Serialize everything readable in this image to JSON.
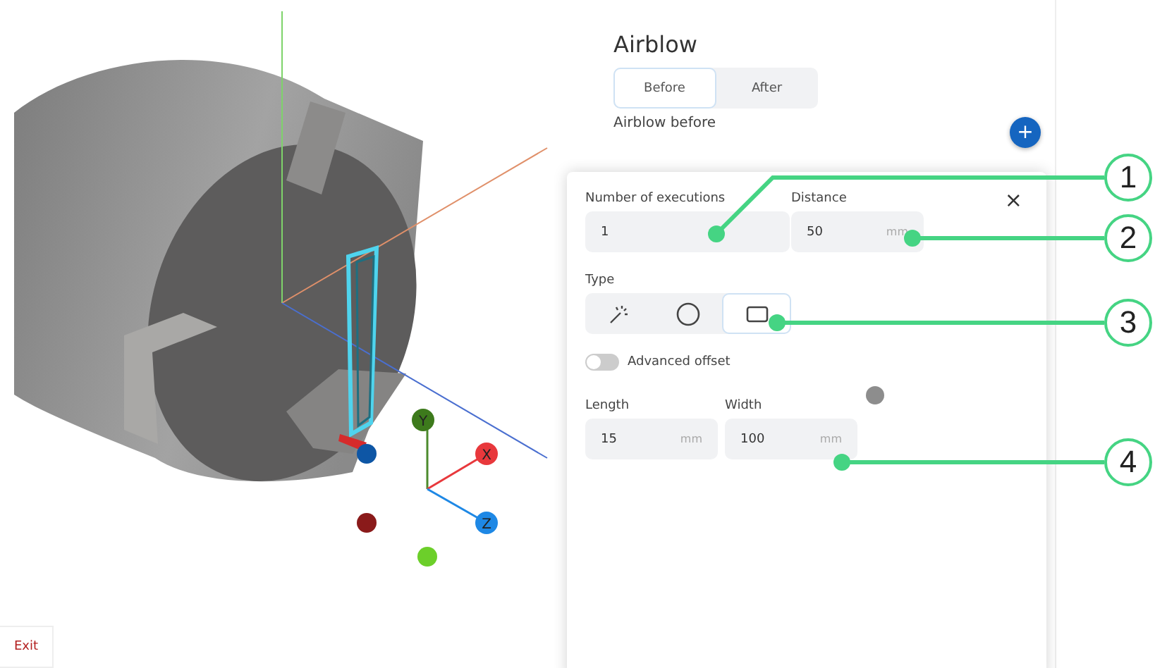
{
  "viewport": {
    "gizmo": [
      {
        "label": "Y",
        "color": "#3d7a1c"
      },
      {
        "label": "X",
        "color": "#e8383c"
      },
      {
        "label": "Z",
        "color": "#1e88e5"
      }
    ],
    "exit_button": "Exit"
  },
  "panel": {
    "title": "Airblow",
    "tabs": [
      {
        "label": "Before",
        "selected": true
      },
      {
        "label": "After",
        "selected": false
      }
    ],
    "section": "Airblow before",
    "add_button": "+"
  },
  "popup": {
    "close": "×",
    "executions": {
      "label": "Number of executions",
      "value": "1"
    },
    "distance": {
      "label": "Distance",
      "value": "50",
      "unit": "mm"
    },
    "type_label": "Type",
    "types": [
      {
        "kind": "sparkle",
        "selected": false
      },
      {
        "kind": "circle",
        "selected": false
      },
      {
        "kind": "rectangle",
        "selected": true
      }
    ],
    "advanced_offset": {
      "label": "Advanced offset",
      "on": false
    },
    "length": {
      "label": "Length",
      "value": "15",
      "unit": "mm"
    },
    "width": {
      "label": "Width",
      "value": "100",
      "unit": "mm"
    }
  },
  "callouts": [
    "1",
    "2",
    "3",
    "4"
  ]
}
